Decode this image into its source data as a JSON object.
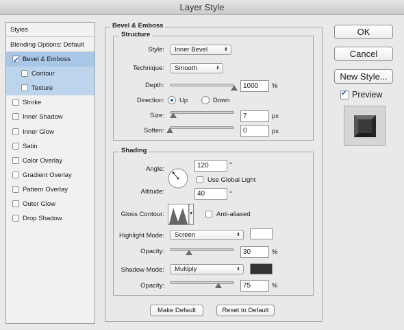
{
  "window": {
    "title": "Layer Style"
  },
  "styles_list": {
    "header": "Styles",
    "blending": "Blending Options: Default",
    "items": [
      {
        "label": "Bevel & Emboss",
        "checked": true,
        "selected": true,
        "indent": false
      },
      {
        "label": "Contour",
        "checked": false,
        "selected": false,
        "indent": true
      },
      {
        "label": "Texture",
        "checked": false,
        "selected": false,
        "indent": true
      },
      {
        "label": "Stroke",
        "checked": false,
        "selected": false,
        "indent": false
      },
      {
        "label": "Inner Shadow",
        "checked": false,
        "selected": false,
        "indent": false
      },
      {
        "label": "Inner Glow",
        "checked": false,
        "selected": false,
        "indent": false
      },
      {
        "label": "Satin",
        "checked": false,
        "selected": false,
        "indent": false
      },
      {
        "label": "Color Overlay",
        "checked": false,
        "selected": false,
        "indent": false
      },
      {
        "label": "Gradient Overlay",
        "checked": false,
        "selected": false,
        "indent": false
      },
      {
        "label": "Pattern Overlay",
        "checked": false,
        "selected": false,
        "indent": false
      },
      {
        "label": "Outer Glow",
        "checked": false,
        "selected": false,
        "indent": false
      },
      {
        "label": "Drop Shadow",
        "checked": false,
        "selected": false,
        "indent": false
      }
    ]
  },
  "bevel": {
    "title": "Bevel & Emboss",
    "structure": {
      "title": "Structure",
      "style_label": "Style:",
      "style_value": "Inner Bevel",
      "technique_label": "Technique:",
      "technique_value": "Smooth",
      "depth_label": "Depth:",
      "depth_value": "1000",
      "depth_unit": "%",
      "depth_level": 1.0,
      "direction_label": "Direction:",
      "dir_up": "Up",
      "dir_down": "Down",
      "direction_selected": "Up",
      "size_label": "Size:",
      "size_value": "7",
      "size_unit": "px",
      "size_level": 0.05,
      "soften_label": "Soften:",
      "soften_value": "0",
      "soften_unit": "px",
      "soften_level": 0.0
    },
    "shading": {
      "title": "Shading",
      "angle_label": "Angle:",
      "angle_value": "120",
      "angle_unit": "°",
      "global_light_label": "Use Global Light",
      "global_light_checked": false,
      "altitude_label": "Altitude:",
      "altitude_value": "40",
      "altitude_unit": "°",
      "gloss_label": "Gloss Contour:",
      "anti_aliased_label": "Anti-aliased",
      "anti_aliased_checked": false,
      "highlight_mode_label": "Highlight Mode:",
      "highlight_mode_value": "Screen",
      "highlight_color": "#ffffff",
      "highlight_opacity_label": "Opacity:",
      "highlight_opacity_value": "30",
      "highlight_opacity_unit": "%",
      "highlight_opacity_level": 0.3,
      "shadow_mode_label": "Shadow Mode:",
      "shadow_mode_value": "Multiply",
      "shadow_color": "#333333",
      "shadow_opacity_label": "Opacity:",
      "shadow_opacity_value": "75",
      "shadow_opacity_unit": "%",
      "shadow_opacity_level": 0.75
    },
    "make_default": "Make Default",
    "reset_default": "Reset to Default"
  },
  "buttons": {
    "ok": "OK",
    "cancel": "Cancel",
    "new_style": "New Style...",
    "preview_label": "Preview",
    "preview_checked": true
  }
}
